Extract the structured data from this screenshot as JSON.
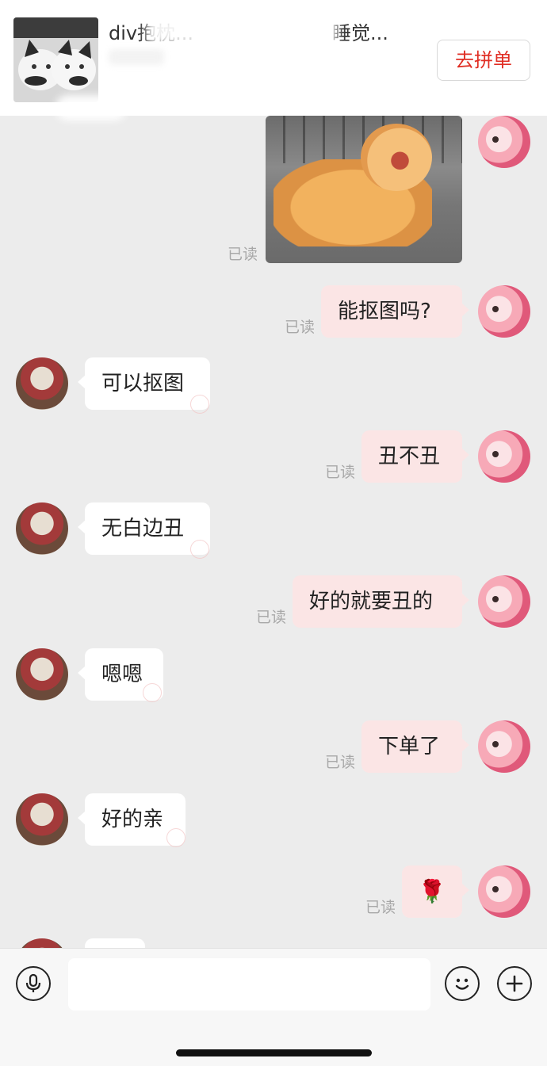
{
  "product": {
    "title": "div抱枕...",
    "title_tail": "睡觉...",
    "buy_label": "去拼单"
  },
  "messages": [
    {
      "side": "self",
      "type": "image",
      "read": "已读",
      "image_desc": "cat-yawning-photo"
    },
    {
      "side": "self",
      "type": "text",
      "text": "能抠图吗?",
      "read": "已读"
    },
    {
      "side": "other",
      "type": "text",
      "text": "可以抠图"
    },
    {
      "side": "self",
      "type": "text",
      "text": "丑不丑",
      "read": "已读"
    },
    {
      "side": "other",
      "type": "text",
      "text": "无白边丑"
    },
    {
      "side": "self",
      "type": "text",
      "text": "好的就要丑的",
      "read": "已读"
    },
    {
      "side": "other",
      "type": "text",
      "text": "嗯嗯"
    },
    {
      "side": "self",
      "type": "text",
      "text": "下单了",
      "read": "已读"
    },
    {
      "side": "other",
      "type": "text",
      "text": "好的亲"
    },
    {
      "side": "self",
      "type": "emoji",
      "text": "🌹",
      "read": "已读"
    }
  ],
  "input": {
    "placeholder": "",
    "voice_icon": "microphone-icon",
    "emoji_icon": "smiley-icon",
    "plus_icon": "plus-icon"
  },
  "colors": {
    "accent": "#e02e24",
    "self_bubble": "#fbe5e5",
    "other_bubble": "#ffffff",
    "chat_bg": "#ececec"
  }
}
